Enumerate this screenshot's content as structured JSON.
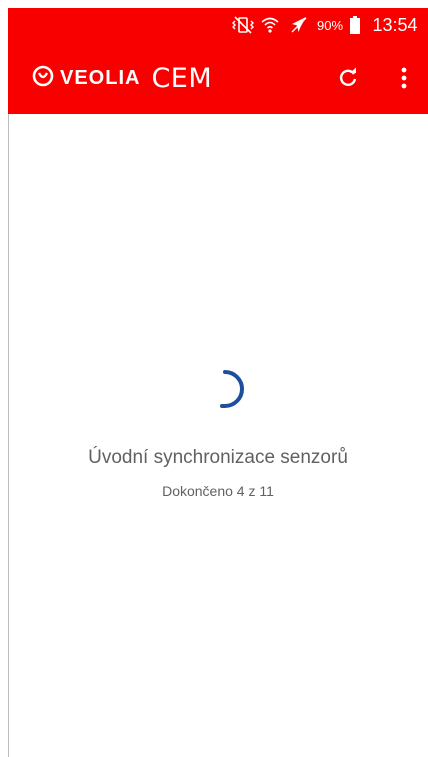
{
  "status_bar": {
    "battery_percent": "90%",
    "time": "13:54",
    "icons": [
      "vibrate-off-icon",
      "wifi-icon",
      "airplane-mode-icon",
      "battery-icon"
    ]
  },
  "app_bar": {
    "brand_name": "VEOLIA",
    "app_name": "CEM",
    "background_color": "#f90000",
    "actions": [
      "refresh-icon",
      "more-vert-icon"
    ]
  },
  "sync": {
    "title": "Úvodní synchronizace senzorů",
    "progress_text": "Dokončeno 4 z 11",
    "spinner_color": "#1e4f9c"
  }
}
